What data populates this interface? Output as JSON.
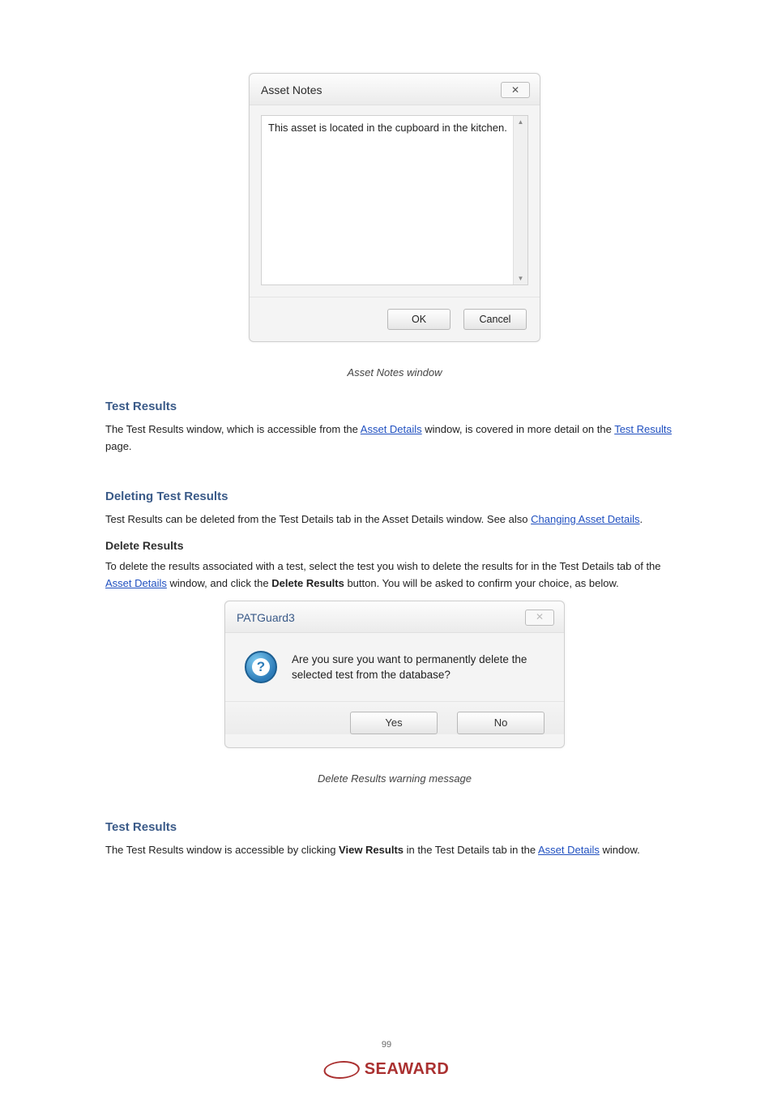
{
  "dialog1": {
    "title": "Asset Notes",
    "content": "This asset is located in the cupboard in the kitchen.",
    "ok": "OK",
    "cancel": "Cancel"
  },
  "figcap1": "Asset Notes window",
  "h_test_results": "Test Results",
  "p_test_results_1a": "The Test Results window, which is accessible from the ",
  "p_test_results_link1": "Asset Details",
  "p_test_results_1b": " window, is covered in more detail on the ",
  "p_test_results_link2": "Test Results",
  "p_test_results_1c": " page.",
  "h_deleting_results": "Deleting Test Results",
  "p_del_1a": "Test Results can be deleted from the Test Details tab in the Asset Details window. See also ",
  "p_del_link1": "Changing Asset Details",
  "p_del_1b": ".",
  "sh_delete": "Delete Results",
  "p_del2_a": "To delete the results associated with a test, select the test you wish to delete the results for in the Test Details tab of the ",
  "p_del2_link": "Asset Details",
  "p_del2_b": " window, and click the ",
  "p_del2_bold": "Delete Results",
  "p_del2_c": " button. You will be asked to confirm your choice, as below.",
  "dialog2": {
    "title": "PATGuard3",
    "message": "Are you sure you want to permanently delete the selected test from the database?",
    "yes": "Yes",
    "no": "No"
  },
  "figcap2": "Delete Results warning message",
  "h_test_results2": "Test Results",
  "p_tr2_a": "The Test Results window is accessible by clicking ",
  "p_tr2_bold": "View Results",
  "p_tr2_b": " in the Test Details tab in the ",
  "p_tr2_link": "Asset Details",
  "p_tr2_c": " window.",
  "page_number": "99",
  "logo": "SEAWARD"
}
